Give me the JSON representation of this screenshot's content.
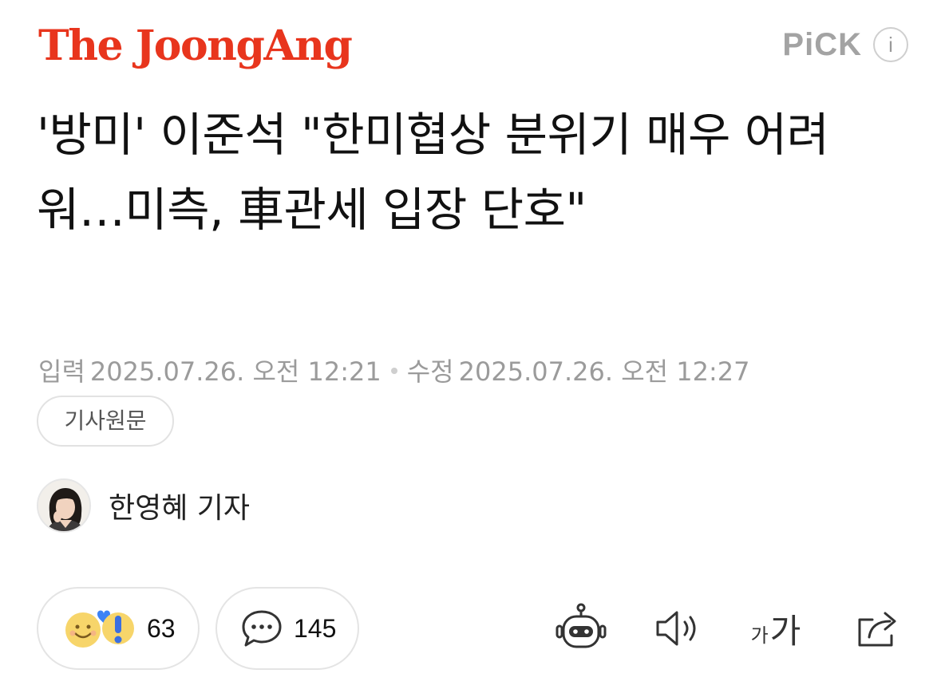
{
  "header": {
    "logo_text": "The JoongAng",
    "pick_label": "PiCK",
    "info_icon_text": "i",
    "brand_color": "#e8351d"
  },
  "article": {
    "headline": "'방미' 이준석 \"한미협상 분위기 매우 어려워…미측, 車관세 입장 단호\"",
    "input_label": "입력",
    "input_time": "2025.07.26. 오전 12:21",
    "edit_label": "수정",
    "edit_time": "2025.07.26. 오전 12:27",
    "original_button": "기사원문",
    "reporter": "한영혜 기자"
  },
  "actions": {
    "reactions_count": "63",
    "comments_count": "145",
    "font_size_small": "가",
    "font_size_large": "가",
    "icons": [
      "reaction-emoji-icon",
      "comment-icon",
      "summary-bot-icon",
      "speaker-icon",
      "font-size-icon",
      "share-icon"
    ]
  }
}
